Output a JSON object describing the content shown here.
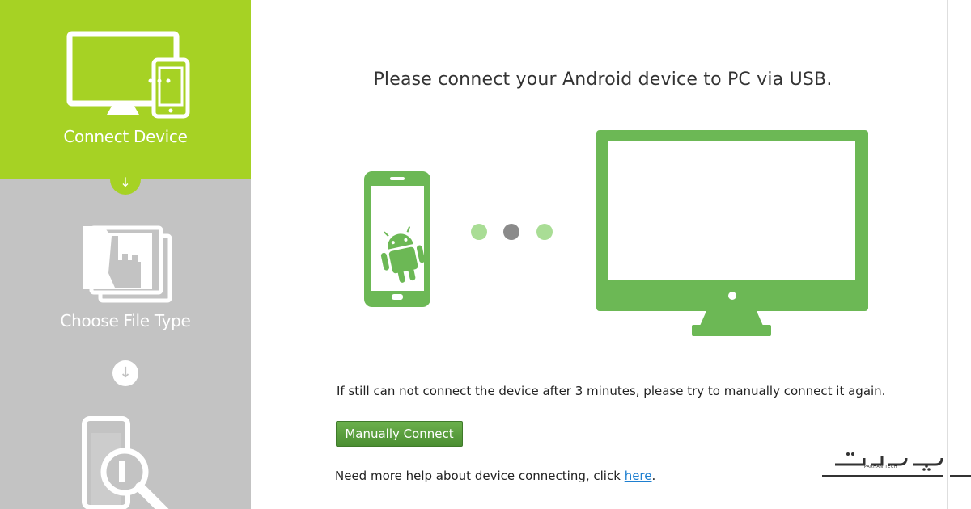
{
  "sidebar": {
    "steps": [
      {
        "label": "Connect Device",
        "icon": "monitor-phone-icon",
        "active": true
      },
      {
        "label": "Choose File Type",
        "icon": "folder-hand-icon",
        "active": false
      },
      {
        "label": "",
        "icon": "phone-search-icon",
        "active": false
      }
    ],
    "arrow_down": "↓",
    "colors": {
      "active": "#a6d224",
      "inactive": "#c3c3c3"
    }
  },
  "main": {
    "headline": "Please connect your Android device to PC via USB.",
    "note": "If still can not connect the device after 3 minutes, please try to manually connect it again.",
    "manual_button": "Manually Connect",
    "help_prefix": "Need more help about device connecting, click ",
    "help_link": "here",
    "help_suffix": ".",
    "illustration": {
      "phone_icon": "android-phone-icon",
      "monitor_icon": "pc-monitor-icon",
      "connector": "connecting-dots",
      "color": "#6cb855"
    }
  },
  "watermark": {
    "logo": "پرهان تک",
    "subtitle": "PARHAN TECH"
  }
}
